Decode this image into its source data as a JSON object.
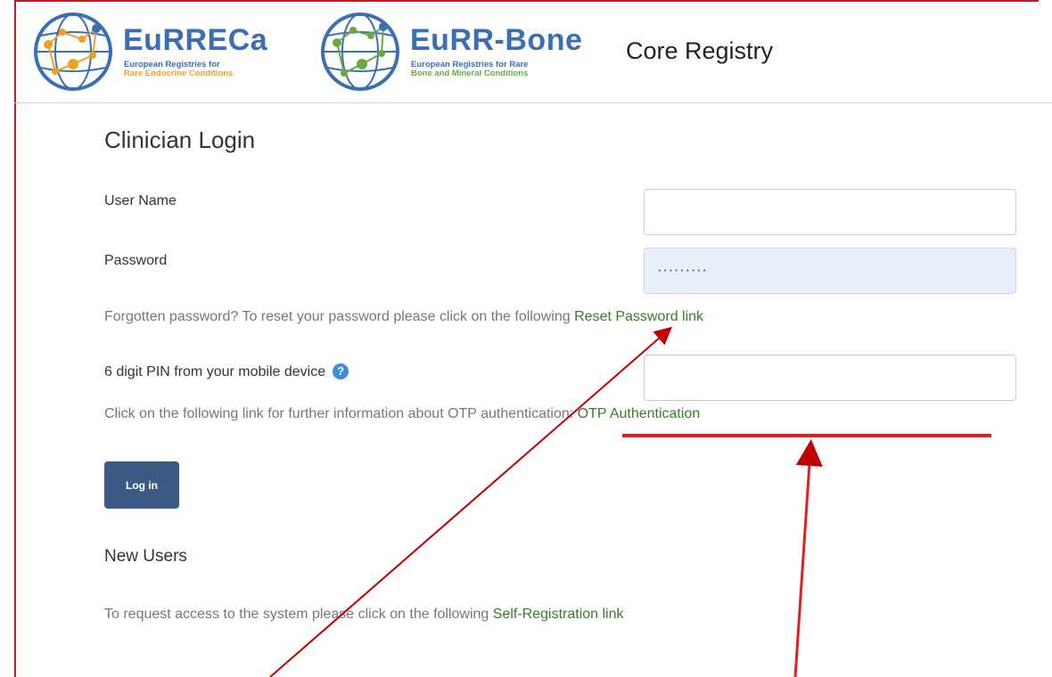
{
  "header": {
    "logo1": {
      "title": "EuRRECa",
      "sub_line1": "European Registries for",
      "sub_line2": "Rare Endocrine Conditions"
    },
    "logo2": {
      "title": "EuRR-Bone",
      "sub_line1": "European Registries for Rare",
      "sub_line2": "Bone and Mineral Conditions"
    },
    "registry_title": "Core Registry"
  },
  "login": {
    "title": "Clinician Login",
    "username_label": "User Name",
    "username_value": "",
    "password_label": "Password",
    "password_value": "·········",
    "forgot_text": "Forgotten password? To reset your password please click on the following",
    "reset_link": "Reset Password link",
    "pin_label": "6 digit PIN from your mobile device",
    "help_glyph": "?",
    "pin_value": "",
    "otp_text": "Click on the following link for further information about OTP authentication:",
    "otp_link": "OTP Authentication",
    "login_button": "Log in"
  },
  "new_users": {
    "title": "New Users",
    "text": "To request access to the system please click on the following",
    "link": "Self-Registration link"
  },
  "colors": {
    "brand_blue": "#3a6fb6",
    "link_green": "#3b7a2a",
    "button_blue": "#3c5a84",
    "annotation_red": "#e02020"
  }
}
